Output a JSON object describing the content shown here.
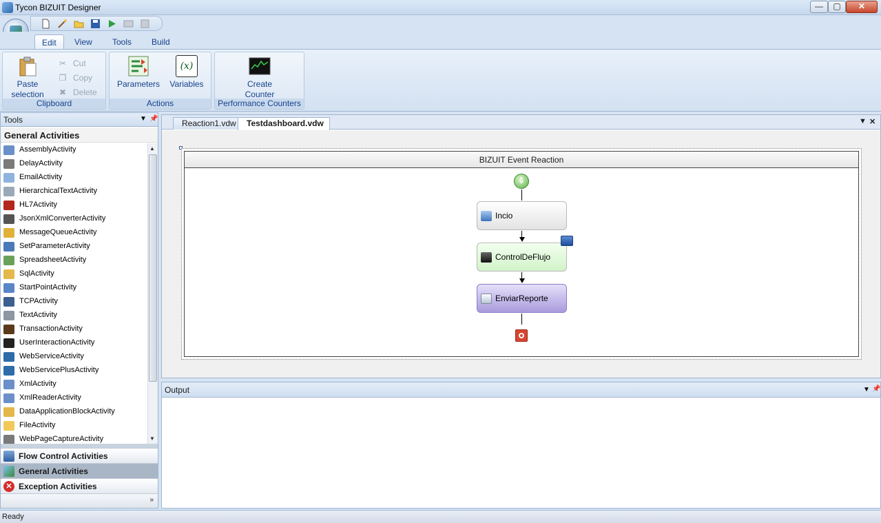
{
  "window": {
    "title": "Tycon BIZUIT Designer",
    "min_glyph": "—",
    "max_glyph": "▢",
    "close_glyph": "✕"
  },
  "qat": {
    "icons": [
      "new-file-icon",
      "wand-icon",
      "open-folder-icon",
      "save-icon",
      "run-icon",
      "build-icon",
      "deploy-icon"
    ]
  },
  "ribbon": {
    "tabs": [
      "Edit",
      "View",
      "Tools",
      "Build"
    ],
    "active_tab": "Edit",
    "groups": {
      "clipboard": {
        "label": "Clipboard",
        "paste_line1": "Paste",
        "paste_line2": "selection",
        "cut": "Cut",
        "copy": "Copy",
        "delete": "Delete"
      },
      "actions": {
        "label": "Actions",
        "parameters": "Parameters",
        "variables": "Variables",
        "variables_glyph": "(x)"
      },
      "perf": {
        "label": "Performance Counters",
        "create_line1": "Create",
        "create_line2": "Counter"
      }
    }
  },
  "tools": {
    "title": "Tools",
    "section": "General Activities",
    "activities": [
      "AssemblyActivity",
      "DelayActivity",
      "EmailActivity",
      "HierarchicalTextActivity",
      "HL7Activity",
      "JsonXmlConverterActivity",
      "MessageQueueActivity",
      "SetParameterActivity",
      "SpreadsheetActivity",
      "SqlActivity",
      "StartPointActivity",
      "TCPActivity",
      "TextActivity",
      "TransactionActivity",
      "UserInteractionActivity",
      "WebServiceActivity",
      "WebServicePlusActivity",
      "XmlActivity",
      "XmlReaderActivity",
      "DataApplicationBlockActivity",
      "FileActivity",
      "WebPageCaptureActivity"
    ],
    "categories": [
      "Flow Control Activities",
      "General Activities",
      "Exception Activities"
    ],
    "active_category": "General Activities"
  },
  "document": {
    "tabs": [
      "Reaction1.vdw",
      "Testdashboard.vdw"
    ],
    "active_tab": "Testdashboard.vdw",
    "reaction_title": "BIZUIT Event Reaction",
    "nodes": [
      "Incio",
      "ControlDeFlujo",
      "EnviarReporte"
    ]
  },
  "output": {
    "title": "Output"
  },
  "status": {
    "text": "Ready"
  },
  "colors": {
    "ribbon_text": "#15428b",
    "start_green": "#5fb04b",
    "end_red": "#d8452f",
    "enviar_purple": "#a99bdc",
    "control_green": "#d1f3c8"
  }
}
